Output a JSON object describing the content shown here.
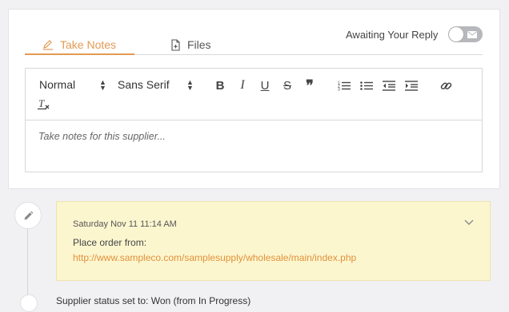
{
  "tabs": [
    {
      "label": "Take Notes",
      "icon": "pencil-icon",
      "active": true
    },
    {
      "label": "Files",
      "icon": "file-add-icon",
      "active": false
    }
  ],
  "awaiting": {
    "label": "Awaiting Your Reply",
    "toggle_on": false,
    "toggle_icon": "mail-icon"
  },
  "toolbar": {
    "format_picker": "Normal",
    "font_picker": "Sans Serif",
    "buttons": [
      "bold",
      "italic",
      "underline",
      "strikethrough",
      "blockquote",
      "ordered-list",
      "bullet-list",
      "outdent",
      "indent",
      "link",
      "clear-format"
    ],
    "bold_glyph": "B",
    "italic_glyph": "I",
    "underline_glyph": "U",
    "strike_glyph": "S",
    "quote_glyph": "❞",
    "clear_glyph": "T"
  },
  "editor": {
    "placeholder": "Take notes for this supplier..."
  },
  "colors": {
    "accent": "#e29a52",
    "note_bg": "#fcf6cf",
    "link": "#e1913a"
  },
  "timeline": {
    "note": {
      "date": "Saturday Nov 11 11:14 AM",
      "text": "Place order from:",
      "link": "http://www.sampleco.com/samplesupply/wholesale/main/index.php"
    },
    "status_text": "Supplier status set to: Won (from In Progress)"
  }
}
